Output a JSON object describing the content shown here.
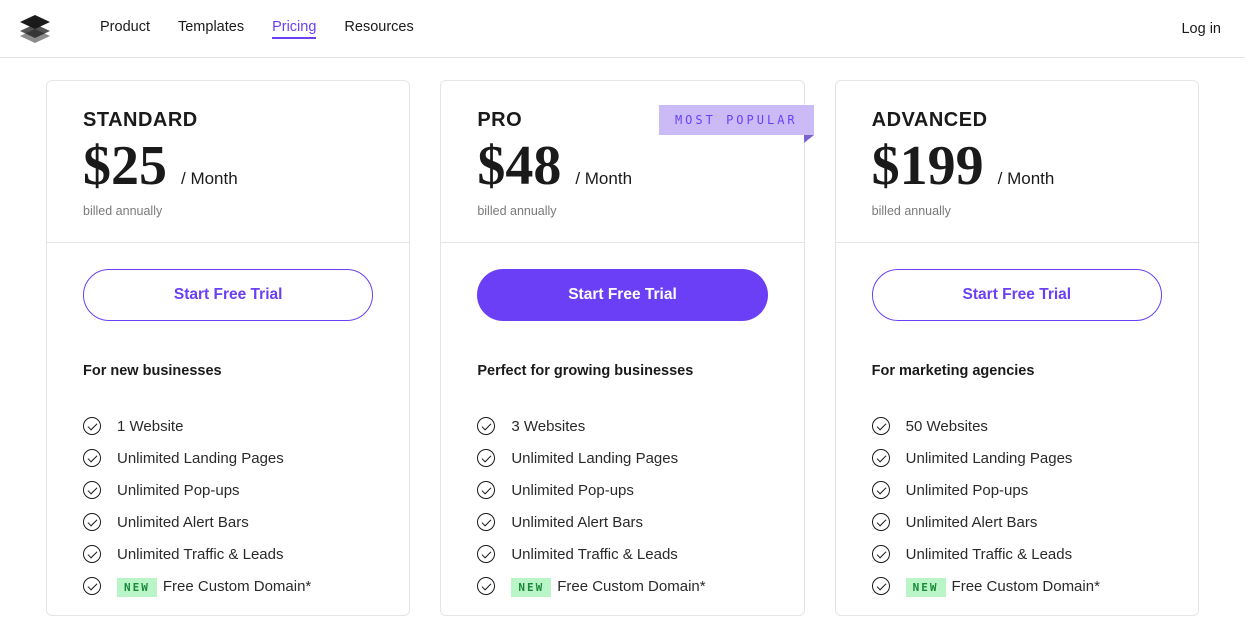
{
  "nav": {
    "items": [
      "Product",
      "Templates",
      "Pricing",
      "Resources"
    ],
    "active": 2
  },
  "login": "Log in",
  "plans": [
    {
      "name": "STANDARD",
      "price": "$25",
      "per": "/ Month",
      "billed": "billed annually",
      "cta": "Start Free Trial",
      "primary": false,
      "popular": null,
      "tagline": "For new businesses",
      "features": [
        {
          "new": false,
          "text": "1 Website"
        },
        {
          "new": false,
          "text": "Unlimited Landing Pages"
        },
        {
          "new": false,
          "text": "Unlimited Pop-ups"
        },
        {
          "new": false,
          "text": "Unlimited Alert Bars"
        },
        {
          "new": false,
          "text": "Unlimited Traffic & Leads"
        },
        {
          "new": true,
          "text": "Free Custom Domain*"
        }
      ]
    },
    {
      "name": "PRO",
      "price": "$48",
      "per": "/ Month",
      "billed": "billed annually",
      "cta": "Start Free Trial",
      "primary": true,
      "popular": "MOST POPULAR",
      "tagline": "Perfect for growing businesses",
      "features": [
        {
          "new": false,
          "text": "3 Websites"
        },
        {
          "new": false,
          "text": "Unlimited Landing Pages"
        },
        {
          "new": false,
          "text": "Unlimited Pop-ups"
        },
        {
          "new": false,
          "text": "Unlimited Alert Bars"
        },
        {
          "new": false,
          "text": "Unlimited Traffic & Leads"
        },
        {
          "new": true,
          "text": "Free Custom Domain*"
        }
      ]
    },
    {
      "name": "ADVANCED",
      "price": "$199",
      "per": "/ Month",
      "billed": "billed annually",
      "cta": "Start Free Trial",
      "primary": false,
      "popular": null,
      "tagline": "For marketing agencies",
      "features": [
        {
          "new": false,
          "text": "50 Websites"
        },
        {
          "new": false,
          "text": "Unlimited Landing Pages"
        },
        {
          "new": false,
          "text": "Unlimited Pop-ups"
        },
        {
          "new": false,
          "text": "Unlimited Alert Bars"
        },
        {
          "new": false,
          "text": "Unlimited Traffic & Leads"
        },
        {
          "new": true,
          "text": "Free Custom Domain*"
        }
      ]
    }
  ],
  "new_label": "NEW"
}
